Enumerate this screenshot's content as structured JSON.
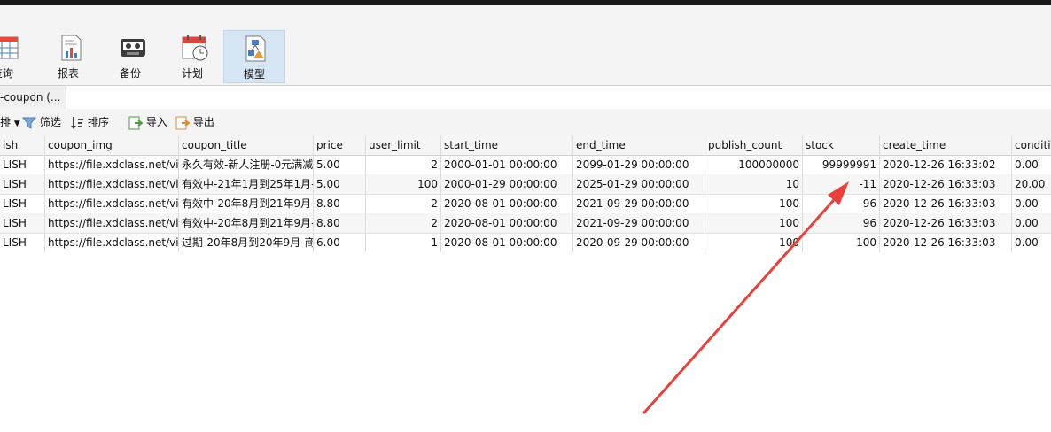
{
  "ribbon": {
    "buttons": [
      {
        "label": "查询",
        "icon": "query-table-icon"
      },
      {
        "label": "报表",
        "icon": "report-icon"
      },
      {
        "label": "备份",
        "icon": "backup-icon"
      },
      {
        "label": "计划",
        "icon": "schedule-icon"
      },
      {
        "label": "模型",
        "icon": "model-icon",
        "active": true
      }
    ]
  },
  "tab": {
    "label": "-coupon (..."
  },
  "toolbar": {
    "sort_prefix": "排",
    "filter_label": "筛选",
    "sort_label": "排序",
    "import_label": "导入",
    "export_label": "导出"
  },
  "table": {
    "columns": [
      "ish",
      "coupon_img",
      "coupon_title",
      "price",
      "user_limit",
      "start_time",
      "end_time",
      "publish_count",
      "stock",
      "create_time",
      "conditio"
    ],
    "rows": [
      [
        "LISH",
        "https://file.xdclass.net/vid",
        "永久有效-新人注册-0元满减",
        "5.00",
        "2",
        "2000-01-01 00:00:00",
        "2099-01-29 00:00:00",
        "100000000",
        "99999991",
        "2020-12-26 16:33:02",
        "0.00"
      ],
      [
        "LISH",
        "https://file.xdclass.net/vid",
        "有效中-21年1月到25年1月-",
        "5.00",
        "100",
        "2000-01-29 00:00:00",
        "2025-01-29 00:00:00",
        "10",
        "-11",
        "2020-12-26 16:33:03",
        "20.00"
      ],
      [
        "LISH",
        "https://file.xdclass.net/vid",
        "有效中-20年8月到21年9月-",
        "8.80",
        "2",
        "2020-08-01 00:00:00",
        "2021-09-29 00:00:00",
        "100",
        "96",
        "2020-12-26 16:33:03",
        "0.00"
      ],
      [
        "LISH",
        "https://file.xdclass.net/vid",
        "有效中-20年8月到21年9月-",
        "8.80",
        "2",
        "2020-08-01 00:00:00",
        "2021-09-29 00:00:00",
        "100",
        "96",
        "2020-12-26 16:33:03",
        "0.00"
      ],
      [
        "LISH",
        "https://file.xdclass.net/vid",
        "过期-20年8月到20年9月-商",
        "6.00",
        "1",
        "2020-08-01 00:00:00",
        "2020-09-29 00:00:00",
        "100",
        "100",
        "2020-12-26 16:33:03",
        "0.00"
      ]
    ]
  },
  "colors": {
    "annotation_arrow": "#e8413a",
    "active_button": "#d6e6f5"
  }
}
